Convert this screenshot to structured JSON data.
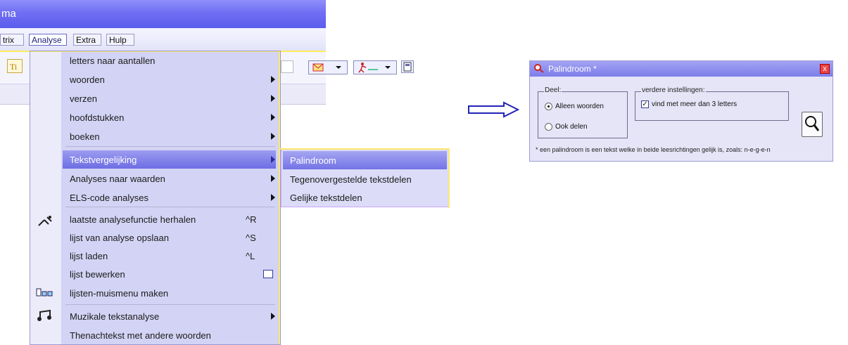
{
  "window": {
    "title": "ma"
  },
  "menubar": {
    "items": [
      "trix",
      "Analyse",
      "Extra",
      "Hulp"
    ]
  },
  "menu": {
    "items": [
      {
        "label": "letters naar aantallen"
      },
      {
        "label": "woorden"
      },
      {
        "label": "verzen"
      },
      {
        "label": "hoofdstukken"
      },
      {
        "label": "boeken"
      },
      {
        "label": "Tekstvergelijking"
      },
      {
        "label": "Analyses naar waarden"
      },
      {
        "label": "ELS-code analyses"
      },
      {
        "label": "laatste analysefunctie herhalen",
        "shortcut": "^R"
      },
      {
        "label": "lijst van analyse opslaan",
        "shortcut": "^S"
      },
      {
        "label": "lijst laden",
        "shortcut": "^L"
      },
      {
        "label": "lijst bewerken"
      },
      {
        "label": "lijsten-muismenu maken"
      },
      {
        "label": "Muzikale tekstanalyse"
      },
      {
        "label": "Thenachtekst met andere woorden"
      }
    ]
  },
  "submenu": {
    "items": [
      "Palindroom",
      "Tegenovergestelde tekstdelen",
      "Gelijke tekstdelen"
    ]
  },
  "dialog": {
    "title": "Palindroom *",
    "close": "x",
    "group1": {
      "label": "Deel:",
      "options": [
        "Alleen woorden",
        "Ook delen"
      ],
      "selected": 0
    },
    "group2": {
      "label": "verdere instellingen:",
      "checkbox_label": "vind met meer dan 3 letters",
      "checked": true
    },
    "note": "* een palindroom is een tekst welke in beide leesrichtingen gelijk is, zoals: n-e-g-e-n"
  },
  "colors": {
    "accent": "#6f6ff4",
    "highlight": "#7a7ae6",
    "rail": "#ffe870"
  }
}
